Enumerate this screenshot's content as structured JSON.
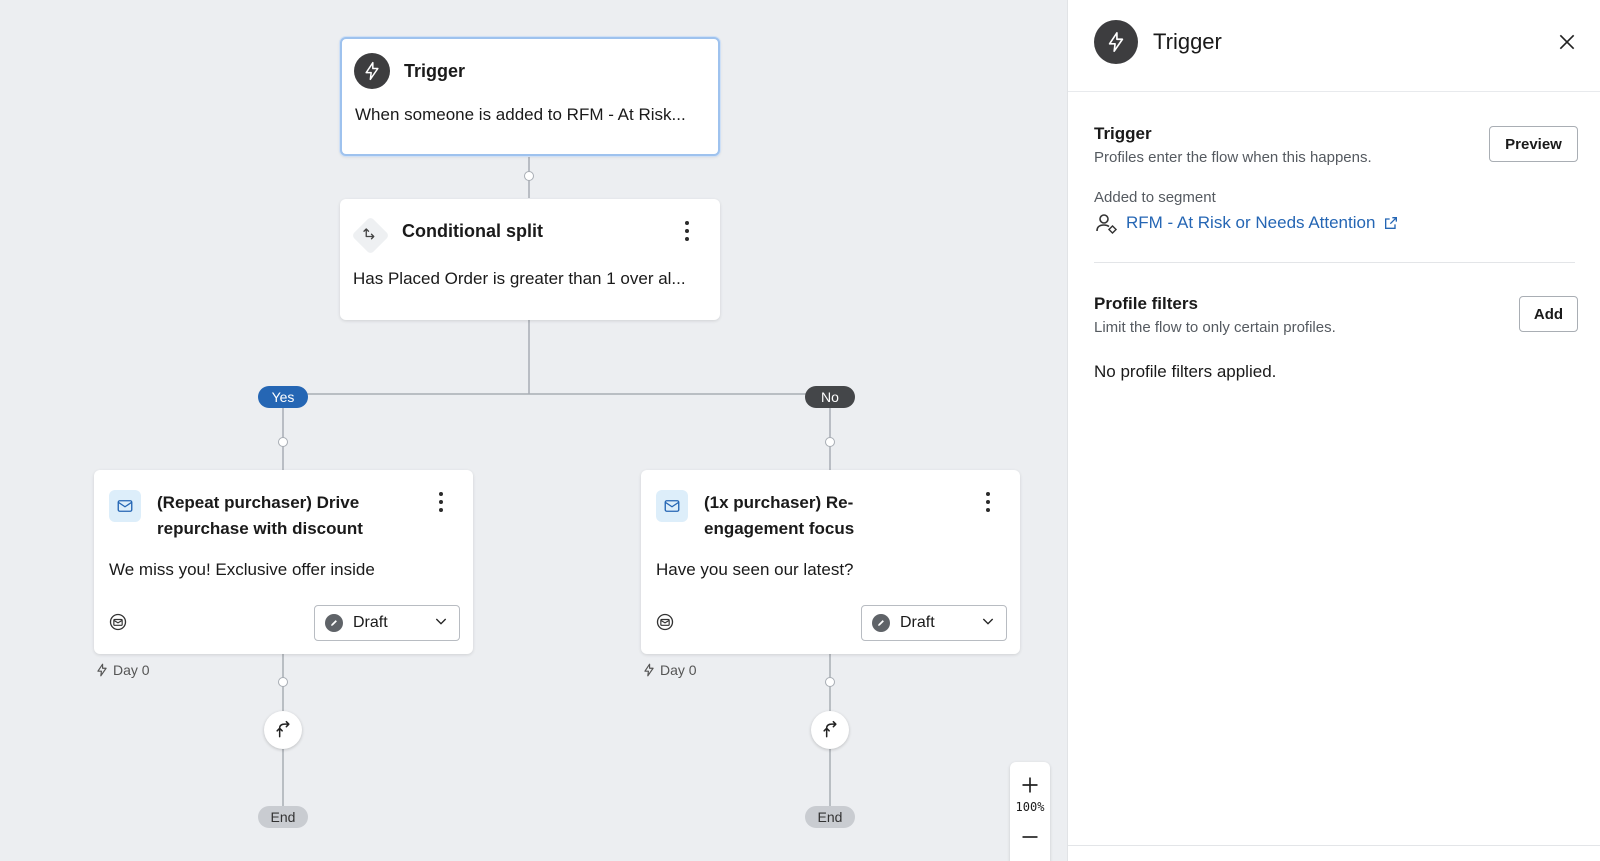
{
  "canvas": {
    "trigger_card": {
      "title": "Trigger",
      "text": "When someone is added to RFM - At Risk..."
    },
    "split_card": {
      "title": "Conditional split",
      "text": "Has Placed Order is greater than 1 over al..."
    },
    "branch_yes": "Yes",
    "branch_no": "No",
    "email_left": {
      "title": "(Repeat purchaser) Drive repurchase with discount",
      "subject": "We miss you! Exclusive offer inside",
      "status": "Draft",
      "delay": "Day 0"
    },
    "email_right": {
      "title": "(1x purchaser) Re-engagement focus",
      "subject": "Have you seen our latest?",
      "status": "Draft",
      "delay": "Day 0"
    },
    "end_left": "End",
    "end_right": "End",
    "zoom_level": "100%"
  },
  "panel": {
    "title": "Trigger",
    "trigger_section": {
      "title": "Trigger",
      "description": "Profiles enter the flow when this happens.",
      "preview_label": "Preview",
      "segment_label": "Added to segment",
      "segment_name": "RFM - At Risk or Needs Attention"
    },
    "filters_section": {
      "title": "Profile filters",
      "description": "Limit the flow to only certain profiles.",
      "add_label": "Add",
      "empty_text": "No profile filters applied."
    }
  },
  "colors": {
    "accent_blue": "#2566b4",
    "no_badge": "#444649",
    "canvas_bg": "#eceef1",
    "icon_dark": "#3d3d3f"
  }
}
